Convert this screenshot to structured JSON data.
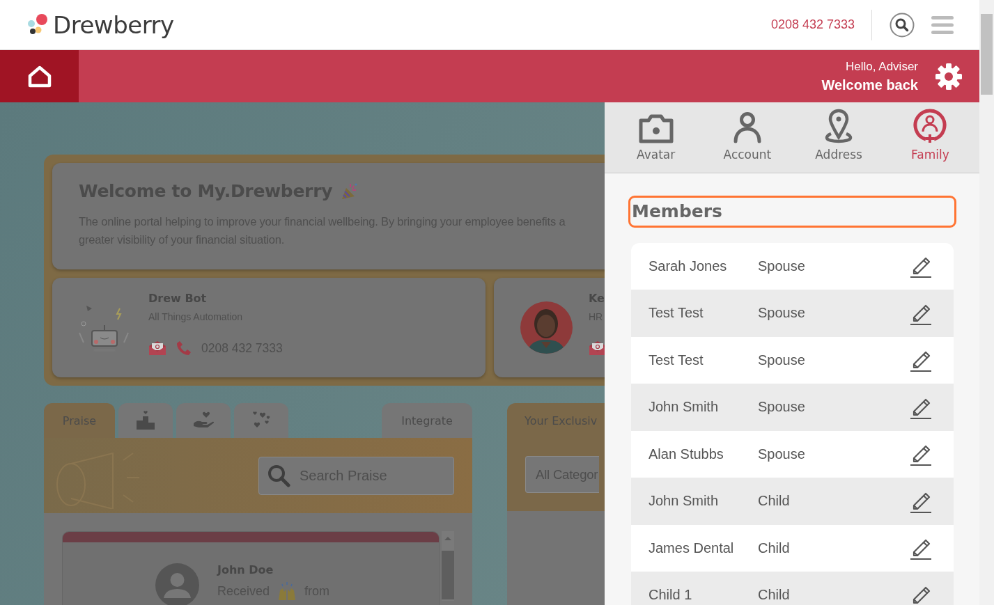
{
  "header": {
    "logo": "Drewberry",
    "phone": "0208 432 7333"
  },
  "band": {
    "greeting": "Hello, Adviser",
    "welcome": "Welcome back"
  },
  "welcome_card": {
    "title": "Welcome to My.Drewberry",
    "text_lines": [
      "The online portal helping to improve your financial wellbeing. By bringing your employee benefits a",
      "greater visibility of your financial situation."
    ]
  },
  "contacts": [
    {
      "kind": "bot",
      "name": "Drew Bot",
      "role": "All Things Automation",
      "phone": "0208 432 7333"
    },
    {
      "name": "Ke",
      "role": "HR"
    }
  ],
  "praise": {
    "tabs": [
      {
        "kind": "text",
        "label": "Praise",
        "selected": true
      },
      {
        "kind": "podium",
        "selected": false
      },
      {
        "kind": "hand-heart",
        "selected": false
      },
      {
        "kind": "hearts",
        "selected": false
      },
      {
        "kind": "text",
        "label": "Integrate",
        "selected": false
      }
    ],
    "search": {
      "placeholder": "Search Praise"
    },
    "post": {
      "name": "John Doe",
      "received": "Received",
      "from": "from"
    }
  },
  "exclusive": {
    "title": "Your Exclusiv",
    "filter": "All Categor"
  },
  "profile": {
    "tabs": [
      {
        "kind": "camera",
        "label": "Avatar",
        "selected": false
      },
      {
        "kind": "person",
        "label": "Account",
        "selected": false
      },
      {
        "kind": "pin",
        "label": "Address",
        "selected": false
      },
      {
        "kind": "family",
        "label": "Family",
        "selected": true
      }
    ],
    "heading": "Members",
    "members": [
      {
        "name": "Sarah Jones",
        "relation": "Spouse"
      },
      {
        "name": "Test Test",
        "relation": "Spouse"
      },
      {
        "name": "Test Test",
        "relation": "Spouse"
      },
      {
        "name": "John Smith",
        "relation": "Spouse"
      },
      {
        "name": "Alan Stubbs",
        "relation": "Spouse"
      },
      {
        "name": "John Smith",
        "relation": "Child"
      },
      {
        "name": "James Dental",
        "relation": "Child"
      },
      {
        "name": "Child 1",
        "relation": "Child"
      }
    ]
  }
}
